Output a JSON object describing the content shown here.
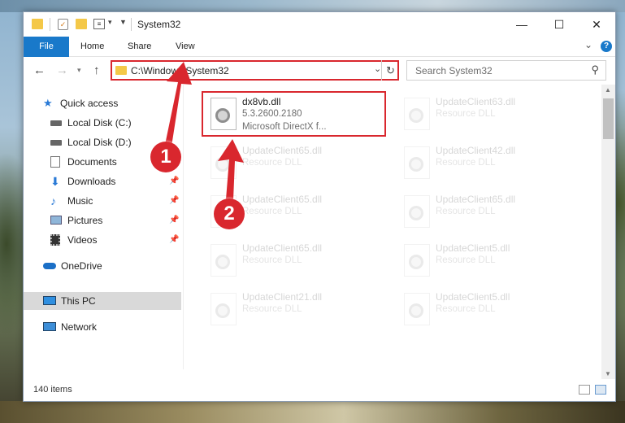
{
  "window": {
    "title": "System32"
  },
  "ribbon": {
    "file": "File",
    "tabs": [
      "Home",
      "Share",
      "View"
    ],
    "help": "?"
  },
  "address": {
    "path": "C:\\Windows\\System32"
  },
  "search": {
    "placeholder": "Search System32"
  },
  "sidebar": {
    "items": [
      {
        "label": "Quick access",
        "icon": "star-icon",
        "pinned": false
      },
      {
        "label": "Local Disk (C:)",
        "icon": "drive-icon",
        "pinned": false
      },
      {
        "label": "Local Disk (D:)",
        "icon": "drive-icon",
        "pinned": false
      },
      {
        "label": "Documents",
        "icon": "documents-icon",
        "pinned": false
      },
      {
        "label": "Downloads",
        "icon": "download-icon",
        "pinned": true
      },
      {
        "label": "Music",
        "icon": "music-icon",
        "pinned": true
      },
      {
        "label": "Pictures",
        "icon": "pictures-icon",
        "pinned": true
      },
      {
        "label": "Videos",
        "icon": "videos-icon",
        "pinned": true
      },
      {
        "label": "OneDrive",
        "icon": "cloud-icon",
        "pinned": false
      },
      {
        "label": "This PC",
        "icon": "computer-icon",
        "pinned": false,
        "selected": true
      },
      {
        "label": "Network",
        "icon": "network-icon",
        "pinned": false
      }
    ]
  },
  "files": [
    {
      "name": "dx8vb.dll",
      "version": "5.3.2600.2180",
      "desc": "Microsoft DirectX f...",
      "highlight": true
    },
    {
      "name": "UpdateClient63.dll",
      "desc": "Resource DLL"
    },
    {
      "name": "UpdateClient65.dll",
      "desc": "Resource DLL"
    },
    {
      "name": "UpdateClient42.dll",
      "desc": "Resource DLL"
    },
    {
      "name": "UpdateClient65.dll",
      "desc": "Resource DLL"
    },
    {
      "name": "UpdateClient65.dll",
      "desc": "Resource DLL"
    },
    {
      "name": "UpdateClient65.dll",
      "desc": "Resource DLL"
    },
    {
      "name": "UpdateClient5.dll",
      "desc": "Resource DLL"
    },
    {
      "name": "UpdateClient21.dll",
      "desc": "Resource DLL"
    },
    {
      "name": "UpdateClient5.dll",
      "desc": "Resource DLL"
    }
  ],
  "status": {
    "count": "140 items"
  },
  "callouts": [
    "1",
    "2"
  ],
  "colors": {
    "accent": "#1979ca",
    "highlight": "#d9272e"
  }
}
